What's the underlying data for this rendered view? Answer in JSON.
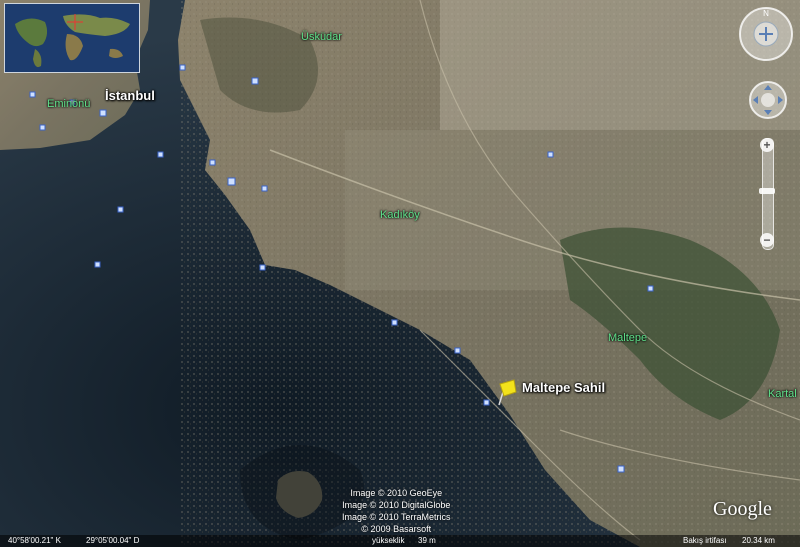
{
  "map": {
    "labels": {
      "uskudar": "Üsküdar",
      "istanbul": "İstanbul",
      "eminonu": "Eminönü",
      "kadikoy": "Kadıköy",
      "maltepe": "Maltepe",
      "kartal": "Kartal",
      "placemark": "Maltepe Sahil"
    },
    "credits": [
      "Image © 2010 GeoEye",
      "Image © 2010 DigitalGlobe",
      "Image © 2010 TerraMetrics",
      "© 2009 Basarsoft"
    ],
    "logo": "Google"
  },
  "status_bar": {
    "latitude": "40°58'00.21\" K",
    "longitude": "29°05'00.04\" D",
    "elevation_label": "yükseklik",
    "elevation_value": "39 m",
    "eye_altitude_label": "Bakış irtifası",
    "eye_altitude_value": "20.34 km"
  },
  "controls": {
    "north_label": "N",
    "zoom_in": "+",
    "zoom_out": "−"
  },
  "colors": {
    "sea": "#1b2a38",
    "land": "#7b7560",
    "label_green": "#5fe08a",
    "pin_yellow": "#f3e21b"
  }
}
